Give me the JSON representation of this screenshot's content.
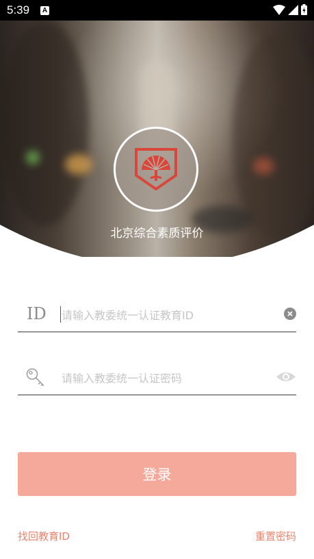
{
  "status_bar": {
    "time": "5:39",
    "notification_letter": "A"
  },
  "app": {
    "name": "北京综合素质评价"
  },
  "id_field": {
    "label": "ID",
    "placeholder": "请输入教委统一认证教育ID",
    "value": ""
  },
  "password_field": {
    "placeholder": "请输入教委统一认证密码",
    "value": ""
  },
  "login": {
    "label": "登录"
  },
  "links": {
    "recover_id": "找回教育ID",
    "reset_password": "重置密码"
  },
  "colors": {
    "accent": "#f5a99b",
    "link": "#e9846f",
    "logo_red": "#d9473a"
  },
  "icons": [
    "wifi-icon",
    "signal-icon",
    "battery-icon",
    "clear-icon",
    "key-icon",
    "eye-icon"
  ]
}
